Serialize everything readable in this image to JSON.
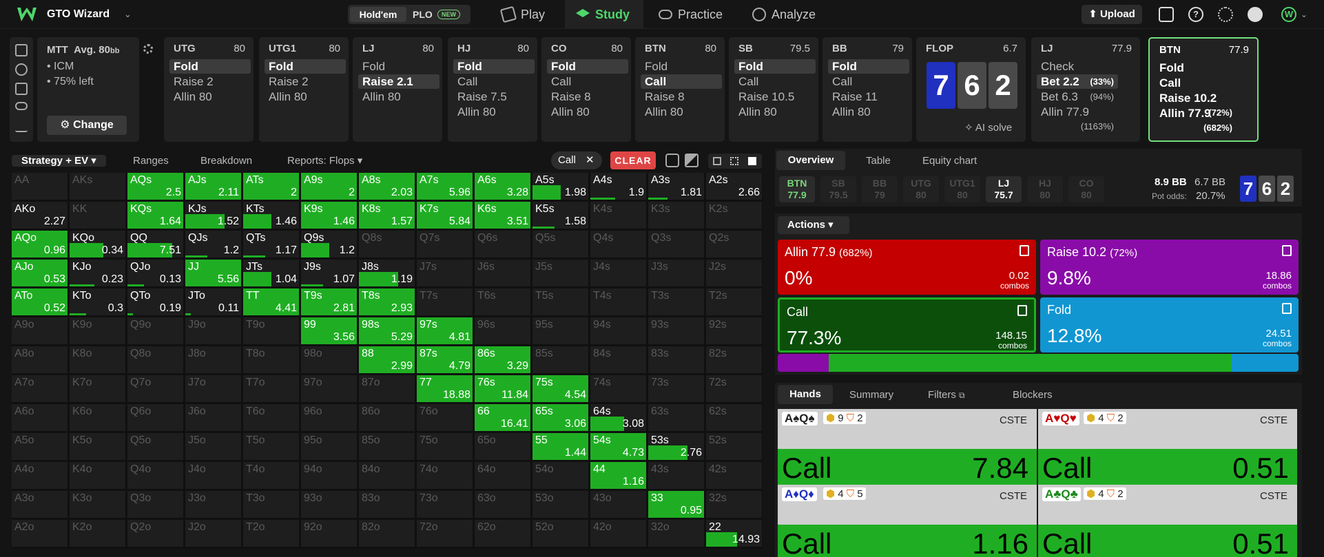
{
  "app": {
    "name": "GTO Wizard",
    "games": [
      "Hold'em",
      "PLO"
    ],
    "new_badge": "NEW",
    "nav": [
      "Play",
      "Study",
      "Practice",
      "Analyze"
    ],
    "upload": "Upload"
  },
  "colors": {
    "green": "#1fae23",
    "red": "#c40000",
    "purple": "#8a0ca8",
    "blue": "#1196d2",
    "board_blue": "#2030c0",
    "board_gray": "#4a4a4a"
  },
  "spot": {
    "format": "MTT",
    "avg_label": "Avg. 80",
    "avg_unit": "bb",
    "notes": [
      "ICM",
      "75% left"
    ],
    "change": "Change"
  },
  "positions": [
    {
      "pos": "UTG",
      "stack": "80",
      "actions": [
        "Fold",
        "Raise 2",
        "Allin 80"
      ],
      "sel": 0
    },
    {
      "pos": "UTG1",
      "stack": "80",
      "actions": [
        "Fold",
        "Raise 2",
        "Allin 80"
      ],
      "sel": 0
    },
    {
      "pos": "LJ",
      "stack": "80",
      "actions": [
        "Fold",
        "Raise 2.1",
        "Allin 80"
      ],
      "sel": 1
    },
    {
      "pos": "HJ",
      "stack": "80",
      "actions": [
        "Fold",
        "Call",
        "Raise 7.5",
        "Allin 80"
      ],
      "sel": 0
    },
    {
      "pos": "CO",
      "stack": "80",
      "actions": [
        "Fold",
        "Call",
        "Raise 8",
        "Allin 80"
      ],
      "sel": 0
    },
    {
      "pos": "BTN",
      "stack": "80",
      "actions": [
        "Fold",
        "Call",
        "Raise 8",
        "Allin 80"
      ],
      "sel": 1
    },
    {
      "pos": "SB",
      "stack": "79.5",
      "actions": [
        "Fold",
        "Call",
        "Raise 10.5",
        "Allin 80"
      ],
      "sel": 0
    },
    {
      "pos": "BB",
      "stack": "79",
      "actions": [
        "Fold",
        "Call",
        "Raise 11",
        "Allin 80"
      ],
      "sel": 0
    }
  ],
  "flop": {
    "label": "FLOP",
    "pot": "6.7",
    "cards": [
      "7",
      "6",
      "2"
    ],
    "ai": "AI solve"
  },
  "lj_card": {
    "pos": "LJ",
    "stack": "77.9",
    "actions": [
      {
        "a": "Check",
        "p": ""
      },
      {
        "a": "Bet 2.2",
        "p": "(33%)"
      },
      {
        "a": "Bet 6.3",
        "p": "(94%)"
      },
      {
        "a": "Allin 77.9",
        "p": "(1163%)"
      }
    ]
  },
  "btn_card": {
    "pos": "BTN",
    "stack": "77.9",
    "actions": [
      {
        "a": "Fold",
        "p": ""
      },
      {
        "a": "Call",
        "p": ""
      },
      {
        "a": "Raise 10.2",
        "p": "(72%)"
      },
      {
        "a": "Allin 77.9",
        "p": "(682%)"
      }
    ]
  },
  "left_tabs": [
    "Strategy + EV",
    "Ranges",
    "Breakdown",
    "Reports: Flops"
  ],
  "filter": {
    "chip": "Call",
    "clear": "CLEAR"
  },
  "right_tabs": [
    "Overview",
    "Table",
    "Equity chart"
  ],
  "chips": [
    {
      "p": "BTN",
      "s": "77.9"
    },
    {
      "p": "SB",
      "s": "79.5"
    },
    {
      "p": "BB",
      "s": "79"
    },
    {
      "p": "UTG",
      "s": "80"
    },
    {
      "p": "UTG1",
      "s": "80"
    },
    {
      "p": "LJ",
      "s": "75.7"
    },
    {
      "p": "HJ",
      "s": "80"
    },
    {
      "p": "CO",
      "s": "80"
    }
  ],
  "pot": {
    "bb1": "8.9 BB",
    "bb2": "6.7 BB",
    "odds_label": "Pot odds:",
    "odds": "20.7%"
  },
  "actions_label": "Actions",
  "actions": [
    {
      "title": "Allin 77.9",
      "pct_of_pot": "(682%)",
      "freq": "0%",
      "combos": "0.02",
      "unit": "combos"
    },
    {
      "title": "Raise 10.2",
      "pct_of_pot": "(72%)",
      "freq": "9.8%",
      "combos": "18.86",
      "unit": "combos"
    },
    {
      "title": "Call",
      "pct_of_pot": "",
      "freq": "77.3%",
      "combos": "148.15",
      "unit": "combos"
    },
    {
      "title": "Fold",
      "pct_of_pot": "",
      "freq": "12.8%",
      "combos": "24.51",
      "unit": "combos"
    }
  ],
  "dist": {
    "raise": 0.098,
    "call": 0.773,
    "fold": 0.128
  },
  "hand_tabs": [
    "Hands",
    "Summary",
    "Filters",
    "Blockers"
  ],
  "hands": [
    {
      "cards": "A♠Q♠",
      "b1": "9",
      "b2": "2",
      "tag": "CSTE",
      "action": "Call",
      "value": "7.84",
      "color": "#222"
    },
    {
      "cards": "A♥Q♥",
      "b1": "4",
      "b2": "2",
      "tag": "CSTE",
      "action": "Call",
      "value": "0.51",
      "color": "#c40000"
    },
    {
      "cards": "A♦Q♦",
      "b1": "4",
      "b2": "5",
      "tag": "CSTE",
      "action": "Call",
      "value": "1.16",
      "color": "#2030c0"
    },
    {
      "cards": "A♣Q♣",
      "b1": "4",
      "b2": "2",
      "tag": "CSTE",
      "action": "Call",
      "value": "0.51",
      "color": "#1a8a1a"
    }
  ],
  "grid": [
    [
      "AA",
      "",
      "",
      0
    ],
    [
      "AKs",
      "",
      "",
      0
    ],
    [
      "AQs",
      "2.5",
      1,
      1
    ],
    [
      "AJs",
      "2.11",
      1,
      1
    ],
    [
      "ATs",
      "2",
      1,
      1
    ],
    [
      "A9s",
      "2",
      1,
      1
    ],
    [
      "A8s",
      "2.03",
      1,
      1
    ],
    [
      "A7s",
      "5.96",
      1,
      1
    ],
    [
      "A6s",
      "3.28",
      1,
      1
    ],
    [
      "A5s",
      "1.98",
      0.5,
      1
    ],
    [
      "A4s",
      "1.9",
      0.45,
      1
    ],
    [
      "A3s",
      "1.81",
      0.35,
      1
    ],
    [
      "A2s",
      "2.66",
      0,
      1
    ],
    [
      "AKo",
      "2.27",
      0,
      1
    ],
    [
      "KK",
      "",
      "",
      0
    ],
    [
      "KQs",
      "1.64",
      1,
      1
    ],
    [
      "KJs",
      "1.52",
      0.7,
      1
    ],
    [
      "KTs",
      "1.46",
      0.5,
      1
    ],
    [
      "K9s",
      "1.46",
      1,
      1
    ],
    [
      "K8s",
      "1.57",
      1,
      1
    ],
    [
      "K7s",
      "5.84",
      1,
      1
    ],
    [
      "K6s",
      "3.51",
      1,
      1
    ],
    [
      "K5s",
      "1.58",
      0.4,
      1
    ],
    [
      "K4s",
      "",
      "",
      0
    ],
    [
      "K3s",
      "",
      "",
      0
    ],
    [
      "K2s",
      "",
      "",
      0
    ],
    [
      "AQo",
      "0.96",
      1,
      1
    ],
    [
      "KQo",
      "0.34",
      0.6,
      1
    ],
    [
      "QQ",
      "7.51",
      0.8,
      1
    ],
    [
      "QJs",
      "1.2",
      0.4,
      1
    ],
    [
      "QTs",
      "1.17",
      0.4,
      1
    ],
    [
      "Q9s",
      "1.2",
      0.5,
      1
    ],
    [
      "Q8s",
      "",
      "",
      0
    ],
    [
      "Q7s",
      "",
      "",
      0
    ],
    [
      "Q6s",
      "",
      "",
      0
    ],
    [
      "Q5s",
      "",
      "",
      0
    ],
    [
      "Q4s",
      "",
      "",
      0
    ],
    [
      "Q3s",
      "",
      "",
      0
    ],
    [
      "Q2s",
      "",
      "",
      0
    ],
    [
      "AJo",
      "0.53",
      1,
      1
    ],
    [
      "KJo",
      "0.23",
      0.45,
      1
    ],
    [
      "QJo",
      "0.13",
      0.3,
      1
    ],
    [
      "JJ",
      "5.56",
      1,
      1
    ],
    [
      "JTs",
      "1.04",
      0.5,
      1
    ],
    [
      "J9s",
      "1.07",
      0.4,
      1
    ],
    [
      "J8s",
      "1.19",
      0.7,
      1
    ],
    [
      "J7s",
      "",
      "",
      0
    ],
    [
      "J6s",
      "",
      "",
      0
    ],
    [
      "J5s",
      "",
      "",
      0
    ],
    [
      "J4s",
      "",
      "",
      0
    ],
    [
      "J3s",
      "",
      "",
      0
    ],
    [
      "J2s",
      "",
      "",
      0
    ],
    [
      "ATo",
      "0.52",
      1,
      1
    ],
    [
      "KTo",
      "0.3",
      0.3,
      1
    ],
    [
      "QTo",
      "0.19",
      0.1,
      1
    ],
    [
      "JTo",
      "0.11",
      0.1,
      1
    ],
    [
      "TT",
      "4.41",
      1,
      1
    ],
    [
      "T9s",
      "2.81",
      1,
      1
    ],
    [
      "T8s",
      "2.93",
      1,
      1
    ],
    [
      "T7s",
      "",
      "",
      0
    ],
    [
      "T6s",
      "",
      "",
      0
    ],
    [
      "T5s",
      "",
      "",
      0
    ],
    [
      "T4s",
      "",
      "",
      0
    ],
    [
      "T3s",
      "",
      "",
      0
    ],
    [
      "T2s",
      "",
      "",
      0
    ],
    [
      "A9o",
      "",
      "",
      0
    ],
    [
      "K9o",
      "",
      "",
      0
    ],
    [
      "Q9o",
      "",
      "",
      0
    ],
    [
      "J9o",
      "",
      "",
      0
    ],
    [
      "T9o",
      "",
      "",
      0
    ],
    [
      "99",
      "3.56",
      1,
      1
    ],
    [
      "98s",
      "5.29",
      1,
      1
    ],
    [
      "97s",
      "4.81",
      1,
      1
    ],
    [
      "96s",
      "",
      "",
      0
    ],
    [
      "95s",
      "",
      "",
      0
    ],
    [
      "94s",
      "",
      "",
      0
    ],
    [
      "93s",
      "",
      "",
      0
    ],
    [
      "92s",
      "",
      "",
      0
    ],
    [
      "A8o",
      "",
      "",
      0
    ],
    [
      "K8o",
      "",
      "",
      0
    ],
    [
      "Q8o",
      "",
      "",
      0
    ],
    [
      "J8o",
      "",
      "",
      0
    ],
    [
      "T8o",
      "",
      "",
      0
    ],
    [
      "98o",
      "",
      "",
      0
    ],
    [
      "88",
      "2.99",
      1,
      1
    ],
    [
      "87s",
      "4.79",
      1,
      1
    ],
    [
      "86s",
      "3.29",
      1,
      1
    ],
    [
      "85s",
      "",
      "",
      0
    ],
    [
      "84s",
      "",
      "",
      0
    ],
    [
      "83s",
      "",
      "",
      0
    ],
    [
      "82s",
      "",
      "",
      0
    ],
    [
      "A7o",
      "",
      "",
      0
    ],
    [
      "K7o",
      "",
      "",
      0
    ],
    [
      "Q7o",
      "",
      "",
      0
    ],
    [
      "J7o",
      "",
      "",
      0
    ],
    [
      "T7o",
      "",
      "",
      0
    ],
    [
      "97o",
      "",
      "",
      0
    ],
    [
      "87o",
      "",
      "",
      0
    ],
    [
      "77",
      "18.88",
      1,
      1
    ],
    [
      "76s",
      "11.84",
      1,
      1
    ],
    [
      "75s",
      "4.54",
      1,
      1
    ],
    [
      "74s",
      "",
      "",
      0
    ],
    [
      "73s",
      "",
      "",
      0
    ],
    [
      "72s",
      "",
      "",
      0
    ],
    [
      "A6o",
      "",
      "",
      0
    ],
    [
      "K6o",
      "",
      "",
      0
    ],
    [
      "Q6o",
      "",
      "",
      0
    ],
    [
      "J6o",
      "",
      "",
      0
    ],
    [
      "T6o",
      "",
      "",
      0
    ],
    [
      "96o",
      "",
      "",
      0
    ],
    [
      "86o",
      "",
      "",
      0
    ],
    [
      "76o",
      "",
      "",
      0
    ],
    [
      "66",
      "16.41",
      1,
      1
    ],
    [
      "65s",
      "3.06",
      1,
      1
    ],
    [
      "64s",
      "3.08",
      0.6,
      1
    ],
    [
      "63s",
      "",
      "",
      0
    ],
    [
      "62s",
      "",
      "",
      0
    ],
    [
      "A5o",
      "",
      "",
      0
    ],
    [
      "K5o",
      "",
      "",
      0
    ],
    [
      "Q5o",
      "",
      "",
      0
    ],
    [
      "J5o",
      "",
      "",
      0
    ],
    [
      "T5o",
      "",
      "",
      0
    ],
    [
      "95o",
      "",
      "",
      0
    ],
    [
      "85o",
      "",
      "",
      0
    ],
    [
      "75o",
      "",
      "",
      0
    ],
    [
      "65o",
      "",
      "",
      0
    ],
    [
      "55",
      "1.44",
      1,
      1
    ],
    [
      "54s",
      "4.73",
      1,
      1
    ],
    [
      "53s",
      "2.76",
      0.7,
      1
    ],
    [
      "52s",
      "",
      "",
      0
    ],
    [
      "A4o",
      "",
      "",
      0
    ],
    [
      "K4o",
      "",
      "",
      0
    ],
    [
      "Q4o",
      "",
      "",
      0
    ],
    [
      "J4o",
      "",
      "",
      0
    ],
    [
      "T4o",
      "",
      "",
      0
    ],
    [
      "94o",
      "",
      "",
      0
    ],
    [
      "84o",
      "",
      "",
      0
    ],
    [
      "74o",
      "",
      "",
      0
    ],
    [
      "64o",
      "",
      "",
      0
    ],
    [
      "54o",
      "",
      "",
      0
    ],
    [
      "44",
      "1.16",
      1,
      1
    ],
    [
      "43s",
      "",
      "",
      0
    ],
    [
      "42s",
      "",
      "",
      0
    ],
    [
      "A3o",
      "",
      "",
      0
    ],
    [
      "K3o",
      "",
      "",
      0
    ],
    [
      "Q3o",
      "",
      "",
      0
    ],
    [
      "J3o",
      "",
      "",
      0
    ],
    [
      "T3o",
      "",
      "",
      0
    ],
    [
      "93o",
      "",
      "",
      0
    ],
    [
      "83o",
      "",
      "",
      0
    ],
    [
      "73o",
      "",
      "",
      0
    ],
    [
      "63o",
      "",
      "",
      0
    ],
    [
      "53o",
      "",
      "",
      0
    ],
    [
      "43o",
      "",
      "",
      0
    ],
    [
      "33",
      "0.95",
      1,
      1
    ],
    [
      "32s",
      "",
      "",
      0
    ],
    [
      "A2o",
      "",
      "",
      0
    ],
    [
      "K2o",
      "",
      "",
      0
    ],
    [
      "Q2o",
      "",
      "",
      0
    ],
    [
      "J2o",
      "",
      "",
      0
    ],
    [
      "T2o",
      "",
      "",
      0
    ],
    [
      "92o",
      "",
      "",
      0
    ],
    [
      "82o",
      "",
      "",
      0
    ],
    [
      "72o",
      "",
      "",
      0
    ],
    [
      "62o",
      "",
      "",
      0
    ],
    [
      "52o",
      "",
      "",
      0
    ],
    [
      "42o",
      "",
      "",
      0
    ],
    [
      "32o",
      "",
      "",
      0
    ],
    [
      "22",
      "14.93",
      0.55,
      1
    ]
  ]
}
